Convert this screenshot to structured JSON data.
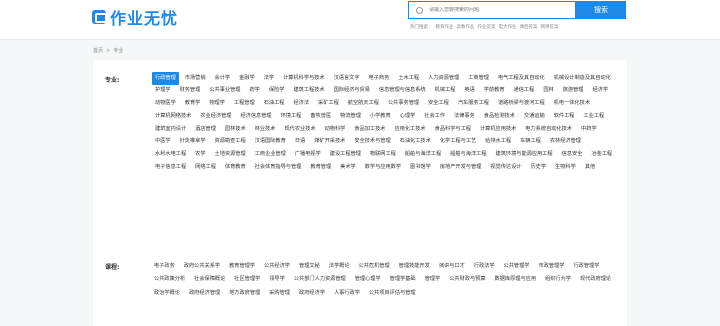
{
  "header": {
    "logo_text": "作业无忧",
    "search_placeholder": "请输入您要搜索的问题",
    "search_button": "搜索",
    "hot_searches": [
      "热门搜索：",
      "教育作业",
      "高数作业",
      "作业答案",
      "电大作业",
      "课后答案",
      "网课答案"
    ]
  },
  "breadcrumb": [
    "首页",
    ">",
    "专业"
  ],
  "majors": {
    "label": "专业:",
    "items": [
      "行政管理",
      "市场营销",
      "会计学",
      "金融学",
      "法学",
      "计算机科学与技术",
      "汉语言文字",
      "电子商务",
      "土木工程",
      "人力资源管理",
      "工商管理",
      "电气工程及其自动化",
      "机械设计制造及其自动化",
      "护理学",
      "财务管理",
      "公共事业管理",
      "药学",
      "保险学",
      "建筑工程技术",
      "国际经济与贸易",
      "信息管理与信息系统",
      "机械工程",
      "英语",
      "学前教育",
      "通信工程",
      "园林",
      "旅游管理",
      "经济学",
      "动物医学",
      "教育学",
      "物理学",
      "工程管理",
      "石油工程",
      "经济法",
      "采矿工程",
      "航空航天工程",
      "公共事务管理",
      "安全工程",
      "汽车服务工程",
      "道路桥梁与渡河工程",
      "机电一体化技术",
      "计算机网络技术",
      "农业经济管理",
      "经济信息管理",
      "环境工程",
      "畜牧兽医",
      "物流管理",
      "小学教育",
      "心理学",
      "社会工作",
      "法律事务",
      "食品检测技术",
      "交通运输",
      "软件工程",
      "工业工程",
      "建筑室内设计",
      "酒店管理",
      "园林技术",
      "林业技术",
      "现代农业技术",
      "动物科学",
      "食品加工技术",
      "应用化工技术",
      "食品科学与工程",
      "计算机应用技术",
      "电力系统自动化技术",
      "中药学",
      "中医学",
      "针灸推拿学",
      "资源勘查工程",
      "汉语国际教育",
      "日语",
      "煤矿开采技术",
      "安全技术与管理",
      "石油化工技术",
      "化学工程与工艺",
      "给排水工程",
      "车辆工程",
      "农林经济管理",
      "水利水电工程",
      "农学",
      "土地资源管理",
      "工商企业管理",
      "广播电视学",
      "建设工程管理",
      "物联网工程",
      "船舶与海洋工程",
      "船舶与海洋工程",
      "建筑环境与能源应用工程",
      "信息安全",
      "冶金工程",
      "电子信息工程",
      "网络工程",
      "体育教育",
      "社会体育指导与管理",
      "教育管理",
      "美术学",
      "数学与应用数学",
      "图书馆学",
      "房地产开发与管理",
      "视觉传达设计",
      "历史学",
      "生物科学",
      "其他"
    ]
  },
  "courses": {
    "label": "课程:",
    "items": [
      "电子政务",
      "政府公共关系学",
      "教育管理学",
      "公共经济学",
      "管理文秘",
      "法学概论",
      "公共危机管理",
      "管理技能开发",
      "演讲与口才",
      "行政法学",
      "公共管理学",
      "市政管理学",
      "行政管理学",
      "公共政策分析",
      "社会保障概论",
      "社区管理学",
      "领导学",
      "公共部门人力资源管理",
      "管理心理学",
      "管理学基础",
      "管理学",
      "公共财政与预算",
      "数据库原理与应用",
      "组织行为学",
      "现代政府理论",
      "政治学概论",
      "政府经济管理",
      "地方政府管理",
      "采购管理",
      "政府经济学",
      "人事行政学",
      "公共项目评估与管理"
    ]
  }
}
